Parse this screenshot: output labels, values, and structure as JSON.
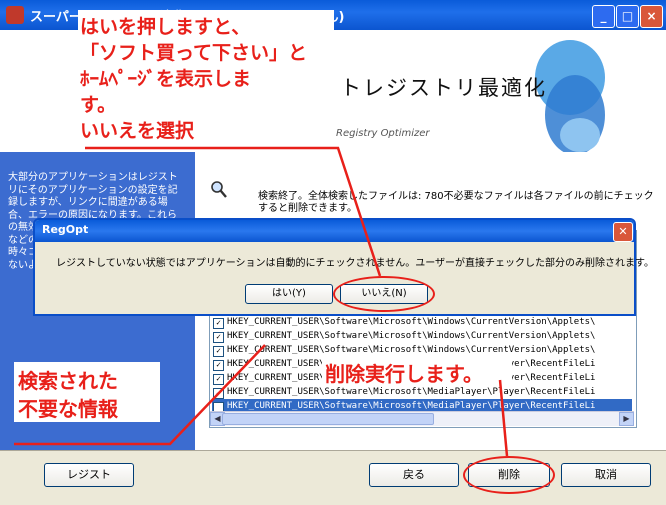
{
  "window": {
    "title": "スーパーレジストリ最適化  (レジストされていません)",
    "controls": [
      "_",
      "□",
      "×"
    ]
  },
  "banner": {
    "title": "トレジストリ最適化",
    "subtitle": "Registry Optimizer"
  },
  "left_panel": {
    "text": "大部分のアプリケーションはレジストリにそのアプリケーションの設定を記録しますが、リンクに間違がある場合、エラーの原因になります。これらの無効な項目を削除するとキャッシュなどのいらないデータを削除します。時々コンピュータではこの機能を使わないようにして下さい。"
  },
  "status": {
    "text": "検索終了。全体検索したファイルは: 780不必要なファイルは各ファイルの前にチェックすると削除できます。"
  },
  "list": {
    "rows": [
      "HKEY_CURRENT_USER\\Software\\Microsoft\\Windows\\CurrentVersion\\Applets\\",
      "HKEY_CURRENT_USER\\Software\\Microsoft\\Windows\\CurrentVersion\\Applets\\",
      "HKEY_CURRENT_USER\\Software\\Microsoft\\Windows\\CurrentVersion\\Applets\\",
      "HKEY_CURRENT_USER\\Software\\Microsoft\\MediaPlayer\\Player\\RecentFileLi",
      "HKEY_CURRENT_USER\\Software\\Microsoft\\MediaPlayer\\Player\\RecentFileLi",
      "HKEY_CURRENT_USER\\Software\\Microsoft\\MediaPlayer\\Player\\RecentFileLi",
      "HKEY_CURRENT_USER\\Software\\Microsoft\\MediaPlayer\\Player\\RecentFileLi"
    ]
  },
  "buttons": {
    "register": "レジスト",
    "back": "戻る",
    "delete": "削除",
    "cancel": "取消"
  },
  "dialog": {
    "title": "RegOpt",
    "message": "レジストしていない状態ではアプリケーションは自動的にチェックされません。ユーザーが直接チェックした部分のみ削除されます。",
    "yes": "はい(Y)",
    "no": "いいえ(N)"
  },
  "annotations": {
    "top_line1": "はいを押しますと、",
    "top_line2": "「ソフト買って下さい」と",
    "top_line3": "ﾎｰﾑﾍﾟｰｼﾞを表示しま",
    "top_line4": "す。",
    "top_line5": "いいえを選択",
    "left_line1": "検索された",
    "left_line2": "不要な情報",
    "delete_note": "削除実行します。"
  },
  "colors": {
    "annotation": "#E8201A",
    "titlebar": "#0A5BD9",
    "panel": "#3C6CD0"
  }
}
